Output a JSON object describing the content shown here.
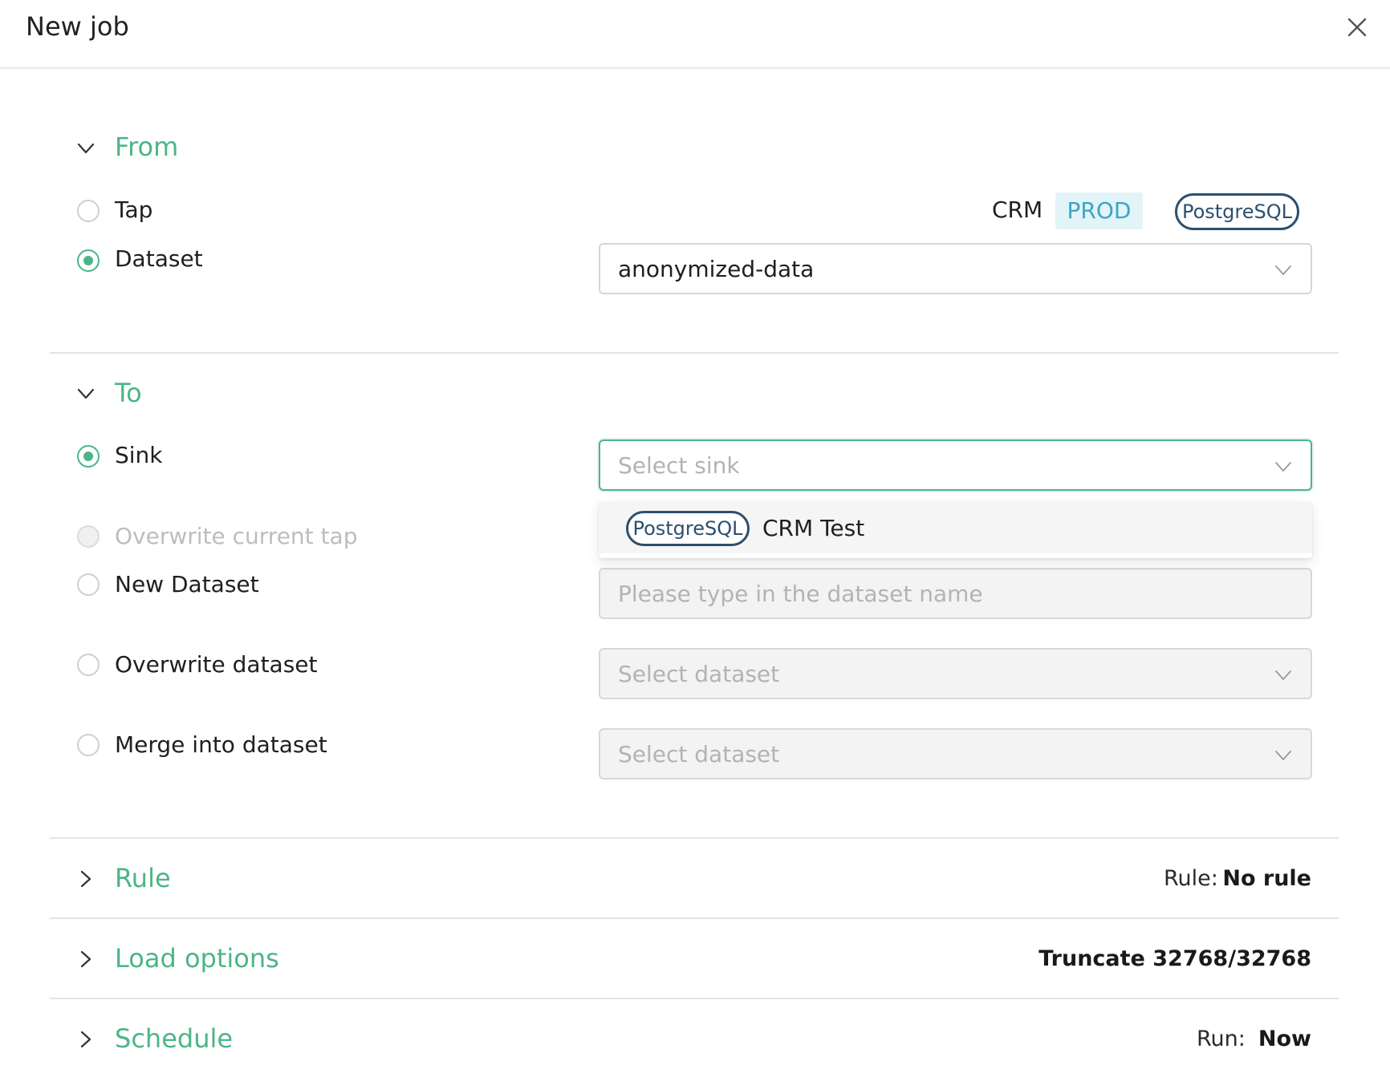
{
  "header": {
    "title": "New job",
    "close_icon": "close-icon"
  },
  "from": {
    "title": "From",
    "options": [
      {
        "label": "Tap",
        "checked": false
      },
      {
        "label": "Dataset",
        "checked": true
      }
    ],
    "tap_info": {
      "name": "CRM",
      "env": "PROD",
      "type": "PostgreSQL"
    },
    "dataset_select": {
      "value": "anonymized-data"
    }
  },
  "to": {
    "title": "To",
    "options": [
      {
        "label": "Sink",
        "checked": true
      },
      {
        "label": "Overwrite current tap",
        "checked": false,
        "disabled": true
      },
      {
        "label": "New Dataset",
        "checked": false
      },
      {
        "label": "Overwrite dataset",
        "checked": false
      },
      {
        "label": "Merge into dataset",
        "checked": false
      }
    ],
    "sink_select": {
      "placeholder": "Select sink"
    },
    "sink_dropdown": [
      {
        "type": "PostgreSQL",
        "name": "CRM Test"
      }
    ],
    "new_dataset_input": {
      "placeholder": "Please type in the dataset name"
    },
    "overwrite_select": {
      "placeholder": "Select dataset"
    },
    "merge_select": {
      "placeholder": "Select dataset"
    }
  },
  "rule": {
    "title": "Rule",
    "label": "Rule:",
    "value": "No rule"
  },
  "load_options": {
    "title": "Load options",
    "value": "Truncate 32768/32768"
  },
  "schedule": {
    "title": "Schedule",
    "label": "Run:",
    "value": "Now"
  },
  "colors": {
    "accent": "#4cb587",
    "pill": "#2c4f6e",
    "env_bg": "#e3f4f8",
    "env_text": "#3aa6c4"
  }
}
